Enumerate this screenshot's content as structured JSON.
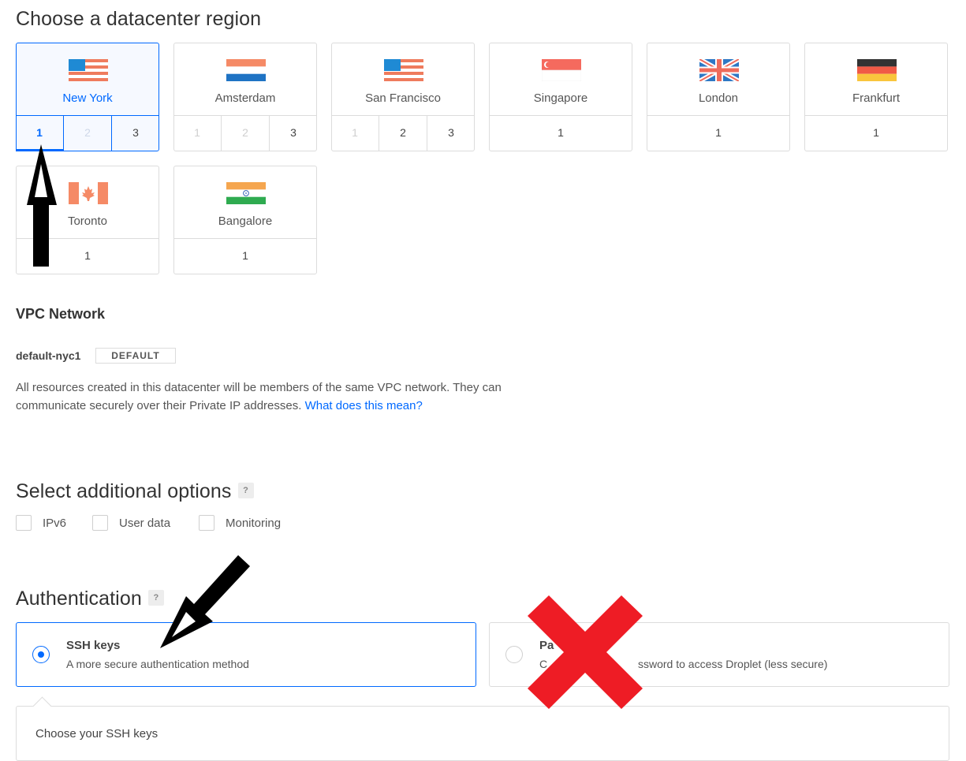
{
  "region": {
    "title": "Choose a datacenter region",
    "cards": [
      {
        "name": "New York",
        "flag": "us-flag-icon",
        "numbers": [
          {
            "label": "1",
            "state": "active"
          },
          {
            "label": "2",
            "state": "disabled"
          },
          {
            "label": "3",
            "state": "enabled"
          }
        ]
      },
      {
        "name": "Amsterdam",
        "flag": "netherlands-flag-icon",
        "numbers": [
          {
            "label": "1",
            "state": "disabled"
          },
          {
            "label": "2",
            "state": "disabled"
          },
          {
            "label": "3",
            "state": "enabled"
          }
        ]
      },
      {
        "name": "San Francisco",
        "flag": "us-flag-icon",
        "numbers": [
          {
            "label": "1",
            "state": "disabled"
          },
          {
            "label": "2",
            "state": "enabled"
          },
          {
            "label": "3",
            "state": "enabled"
          }
        ]
      },
      {
        "name": "Singapore",
        "flag": "singapore-flag-icon",
        "numbers": [
          {
            "label": "1",
            "state": "enabled"
          }
        ]
      },
      {
        "name": "London",
        "flag": "uk-flag-icon",
        "numbers": [
          {
            "label": "1",
            "state": "enabled"
          }
        ]
      },
      {
        "name": "Frankfurt",
        "flag": "germany-flag-icon",
        "numbers": [
          {
            "label": "1",
            "state": "enabled"
          }
        ]
      },
      {
        "name": "Toronto",
        "flag": "canada-flag-icon",
        "numbers": [
          {
            "label": "1",
            "state": "enabled"
          }
        ]
      },
      {
        "name": "Bangalore",
        "flag": "india-flag-icon",
        "numbers": [
          {
            "label": "1",
            "state": "enabled"
          }
        ]
      }
    ],
    "selected_region": "New York",
    "selected_number": "1"
  },
  "vpc": {
    "title": "VPC Network",
    "name": "default-nyc1",
    "badge": "DEFAULT",
    "description": "All resources created in this datacenter will be members of the same VPC network. They can communicate securely over their Private IP addresses.",
    "link": "What does this mean?"
  },
  "options": {
    "title": "Select additional options",
    "help": "?",
    "items": [
      {
        "label": "IPv6",
        "checked": false
      },
      {
        "label": "User data",
        "checked": false
      },
      {
        "label": "Monitoring",
        "checked": false
      }
    ]
  },
  "authentication": {
    "title": "Authentication",
    "help": "?",
    "methods": [
      {
        "title": "SSH keys",
        "description": "A more secure authentication method",
        "selected": true
      },
      {
        "title": "Pa",
        "description_left": "C",
        "description_right": "ssword to access Droplet (less secure)",
        "selected": false
      }
    ],
    "ssh_panel_title": "Choose your SSH keys"
  },
  "colors": {
    "accent": "#0069ff",
    "border": "#dcdcdc",
    "red_x": "#ee1c25"
  },
  "annotations": [
    {
      "name": "up-arrow-icon",
      "points_to": "New York datacenter 1"
    },
    {
      "name": "diagonal-arrow-icon",
      "points_to": "SSH keys option"
    },
    {
      "name": "red-x-icon",
      "marks": "Password option"
    }
  ]
}
